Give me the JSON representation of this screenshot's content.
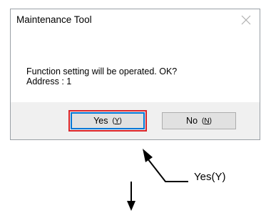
{
  "dialog": {
    "title": "Maintenance Tool",
    "message_line1": "Function setting will be operated. OK?",
    "message_line2": "Address : 1",
    "buttons": {
      "yes_label": "Yes",
      "yes_mnemonic_open": "(",
      "yes_mnemonic_letter": "Y",
      "yes_mnemonic_close": ")",
      "no_label": "No",
      "no_mnemonic_open": "(",
      "no_mnemonic_letter": "N",
      "no_mnemonic_close": ")"
    }
  },
  "annotation": {
    "callout_text": "Yes(Y)"
  },
  "colors": {
    "focus_blue": "#0078d7",
    "highlight_red": "#d9252a",
    "footer_bg": "#f0f0f0"
  },
  "icons": {
    "close": "close-icon",
    "callout_arrow": "arrow-up-left-icon",
    "flow_arrow": "arrow-down-icon"
  }
}
